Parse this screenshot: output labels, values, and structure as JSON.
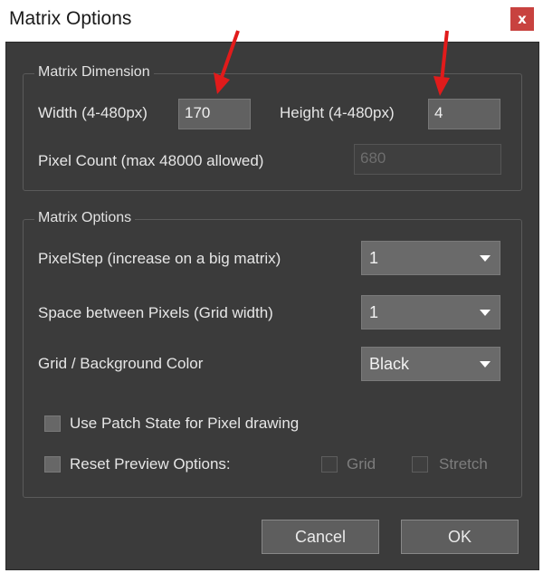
{
  "window": {
    "title": "Matrix Options",
    "close_label": "x"
  },
  "dimension_group": {
    "title": "Matrix Dimension",
    "width_label": "Width (4-480px)",
    "width_value": "170",
    "height_label": "Height (4-480px)",
    "height_value": "4",
    "pixel_count_label": "Pixel Count (max 48000 allowed)",
    "pixel_count_value": "680"
  },
  "options_group": {
    "title": "Matrix Options",
    "pixelstep_label": "PixelStep (increase on a big matrix)",
    "pixelstep_value": "1",
    "space_label": "Space between Pixels (Grid width)",
    "space_value": "1",
    "color_label": "Grid / Background Color",
    "color_value": "Black",
    "patch_state_label": "Use Patch State for Pixel drawing",
    "reset_preview_label": "Reset Preview Options:",
    "grid_label": "Grid",
    "stretch_label": "Stretch"
  },
  "buttons": {
    "cancel": "Cancel",
    "ok": "OK"
  },
  "colors": {
    "annotation_arrow": "#e11b1b",
    "close_button": "#c8423f",
    "dialog_background": "#3b3b3b"
  }
}
